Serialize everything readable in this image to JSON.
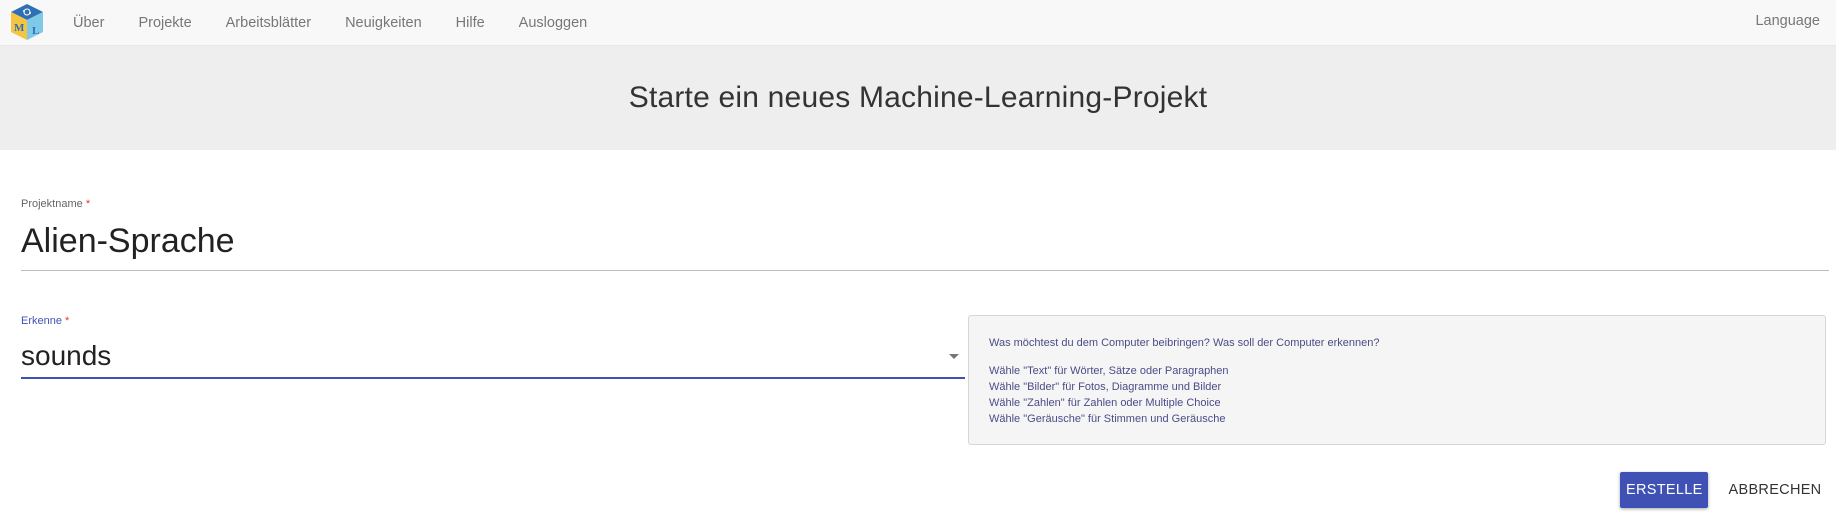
{
  "nav": {
    "items": [
      {
        "label": "Über"
      },
      {
        "label": "Projekte"
      },
      {
        "label": "Arbeitsblätter"
      },
      {
        "label": "Neuigkeiten"
      },
      {
        "label": "Hilfe"
      },
      {
        "label": "Ausloggen"
      }
    ],
    "language": "Language",
    "logo_letters": {
      "m": "M",
      "l": "L"
    }
  },
  "header": {
    "title": "Starte ein neues Machine-Learning-Projekt"
  },
  "form": {
    "project_name": {
      "label": "Projektname",
      "required_mark": "*",
      "value": "Alien-Sprache"
    },
    "recognize": {
      "label": "Erkenne",
      "required_mark": "*",
      "value": "sounds"
    }
  },
  "help": {
    "question": "Was möchtest du dem Computer beibringen? Was soll der Computer erkennen?",
    "lines": [
      "Wähle \"Text\" für Wörter, Sätze oder Paragraphen",
      "Wähle \"Bilder\" für Fotos, Diagramme und Bilder",
      "Wähle \"Zahlen\" für Zahlen oder Multiple Choice",
      "Wähle \"Geräusche\" für Stimmen und Geräusche"
    ]
  },
  "buttons": {
    "create": "ERSTELLE",
    "cancel": "ABBRECHEN"
  },
  "colors": {
    "accent": "#3f51b5",
    "required": "#e53935",
    "help_text": "#4b4c86"
  }
}
